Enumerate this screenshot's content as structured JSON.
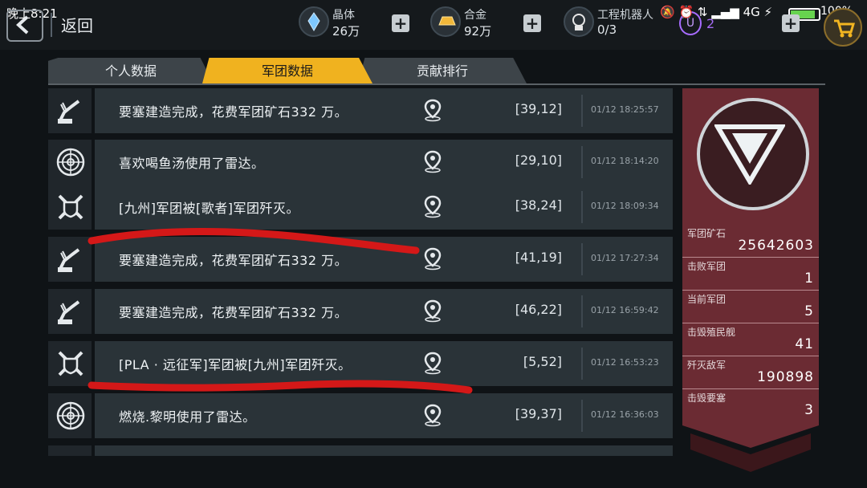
{
  "status_bar": {
    "time": "晚上8:21",
    "network": "4G",
    "battery": "100%"
  },
  "header": {
    "back_label": "返回",
    "resources": [
      {
        "name": "晶体",
        "value": "26万",
        "icon": "crystal-icon"
      },
      {
        "name": "合金",
        "value": "92万",
        "icon": "alloy-icon"
      },
      {
        "name": "工程机器人",
        "value": "0/3",
        "icon": "robot-icon"
      }
    ],
    "premium_count": "2"
  },
  "tabs": [
    {
      "label": "个人数据",
      "active": false
    },
    {
      "label": "军团数据",
      "active": true
    },
    {
      "label": "贡献排行",
      "active": false
    }
  ],
  "log": [
    {
      "icon": "construction-icon",
      "message": "要塞建造完成，花费军团矿石332 万。",
      "coord": "[39,12]",
      "time": "01/12 18:25:57"
    },
    {
      "icon": "radar-icon",
      "message": "喜欢喝鱼汤使用了雷达。",
      "coord": "[29,10]",
      "time": "01/12 18:14:20"
    },
    {
      "icon": "crossed-swords-icon",
      "message": "[九州]军团被[歌者]军团歼灭。",
      "coord": "[38,24]",
      "time": "01/12 18:09:34"
    },
    {
      "icon": "construction-icon",
      "message": "要塞建造完成，花费军团矿石332 万。",
      "coord": "[41,19]",
      "time": "01/12 17:27:34"
    },
    {
      "icon": "construction-icon",
      "message": "要塞建造完成，花费军团矿石332 万。",
      "coord": "[46,22]",
      "time": "01/12 16:59:42"
    },
    {
      "icon": "crossed-swords-icon",
      "message": "[PLA · 远征军]军团被[九州]军团歼灭。",
      "coord": "[5,52]",
      "time": "01/12 16:53:23"
    },
    {
      "icon": "radar-icon",
      "message": "燃烧.黎明使用了雷达。",
      "coord": "[39,37]",
      "time": "01/12 16:36:03"
    }
  ],
  "stats": [
    {
      "label": "军团矿石",
      "value": "25642603"
    },
    {
      "label": "击败军团",
      "value": "1"
    },
    {
      "label": "当前军团",
      "value": "5"
    },
    {
      "label": "击毁殖民舰",
      "value": "41"
    },
    {
      "label": "歼灭敌军",
      "value": "190898"
    },
    {
      "label": "击毁要塞",
      "value": "3"
    }
  ],
  "colors": {
    "accent": "#f0b21f",
    "panel": "#6b2b33",
    "row": "#2a3338",
    "mark": "#d41818"
  }
}
